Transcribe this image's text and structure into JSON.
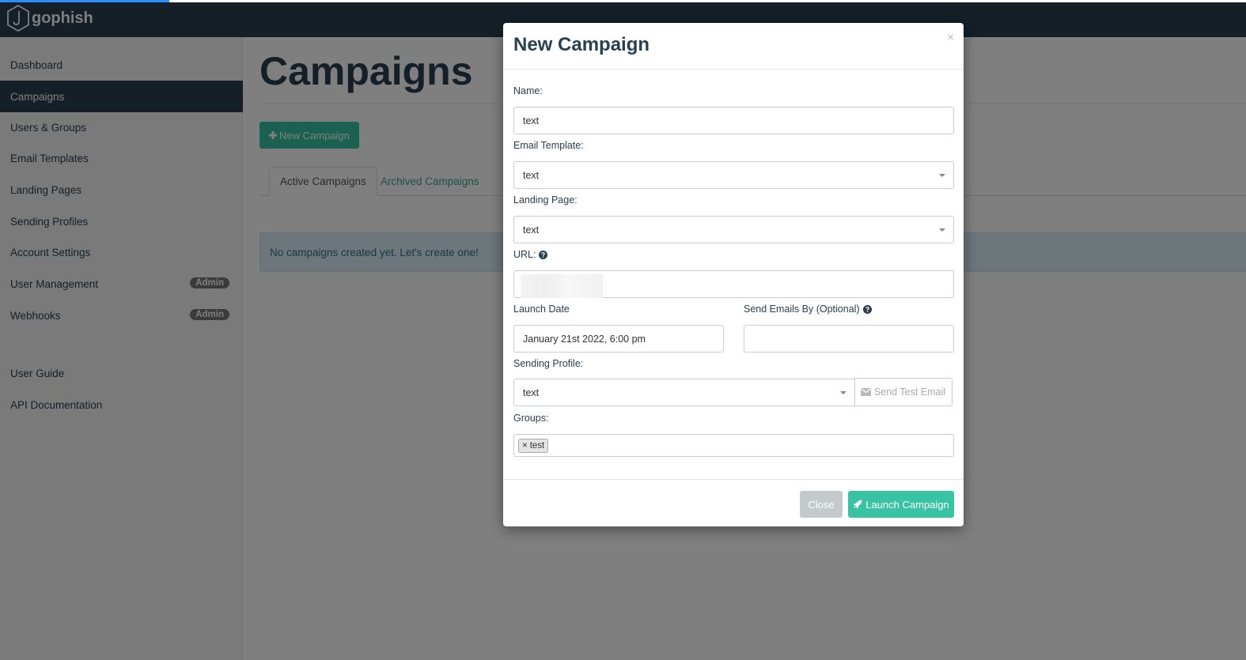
{
  "app": {
    "brand": "gophish"
  },
  "sidebar": {
    "items": [
      {
        "label": "Dashboard",
        "active": false
      },
      {
        "label": "Campaigns",
        "active": true
      },
      {
        "label": "Users & Groups",
        "active": false
      },
      {
        "label": "Email Templates",
        "active": false
      },
      {
        "label": "Landing Pages",
        "active": false
      },
      {
        "label": "Sending Profiles",
        "active": false
      },
      {
        "label": "Account Settings",
        "active": false
      },
      {
        "label": "User Management",
        "badge": "Admin"
      },
      {
        "label": "Webhooks",
        "badge": "Admin"
      }
    ],
    "footer_items": [
      {
        "label": "User Guide"
      },
      {
        "label": "API Documentation"
      }
    ]
  },
  "main": {
    "title": "Campaigns",
    "new_button": "New Campaign",
    "tabs": [
      {
        "label": "Active Campaigns",
        "active": true
      },
      {
        "label": "Archived Campaigns",
        "active": false
      }
    ],
    "empty_message": "No campaigns created yet. Let's create one!"
  },
  "modal": {
    "title": "New Campaign",
    "close_symbol": "×",
    "fields": {
      "name": {
        "label": "Name:",
        "value": "text"
      },
      "email_template": {
        "label": "Email Template:",
        "value": "text"
      },
      "landing_page": {
        "label": "Landing Page:",
        "value": "text"
      },
      "url": {
        "label": "URL:",
        "value": ""
      },
      "launch_date": {
        "label": "Launch Date",
        "value": "January 21st 2022, 6:00 pm"
      },
      "send_by": {
        "label": "Send Emails By (Optional)",
        "value": ""
      },
      "sending_profile": {
        "label": "Sending Profile:",
        "value": "text"
      },
      "groups": {
        "label": "Groups:",
        "tags": [
          "test"
        ],
        "tag_remove": "×"
      }
    },
    "send_test_email": "Send Test Email",
    "close_button": "Close",
    "launch_button": "Launch Campaign"
  },
  "colors": {
    "navbar": "#283f50",
    "accent": "#37c3a4",
    "progress": "#2a8dff"
  },
  "icons": {
    "brand": "gophish-hook-icon",
    "new": "plus-icon",
    "help": "question-circle-icon",
    "mail": "envelope-icon",
    "launch": "rocket-icon"
  }
}
